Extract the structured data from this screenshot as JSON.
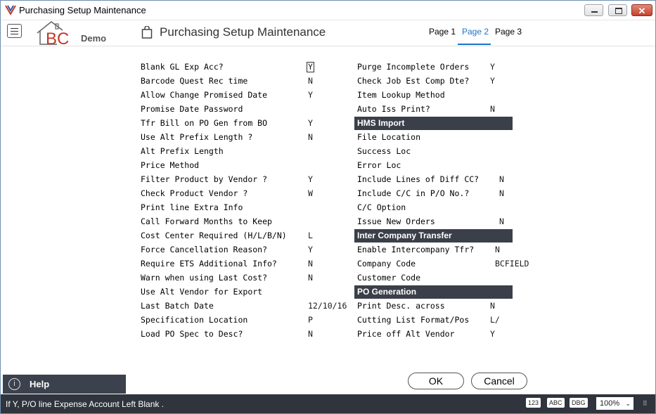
{
  "window": {
    "title": "Purchasing Setup Maintenance"
  },
  "header": {
    "logo_text": "Demo",
    "logo_letters": "BC",
    "page_title": "Purchasing Setup Maintenance",
    "tabs": [
      {
        "label": "Page 1"
      },
      {
        "label": "Page 2",
        "active": true
      },
      {
        "label": "Page 3"
      }
    ]
  },
  "left_fields": [
    {
      "label": "Blank GL Exp Acc?",
      "value": "Y"
    },
    {
      "label": "Barcode Quest Rec time",
      "value": "N"
    },
    {
      "label": "Allow Change Promised Date",
      "value": "Y"
    },
    {
      "label": "Promise Date Password",
      "value": ""
    },
    {
      "label": "Tfr Bill on PO Gen from BO",
      "value": "Y"
    },
    {
      "label": "Use Alt Prefix Length ?",
      "value": "N"
    },
    {
      "label": "Alt Prefix Length",
      "value": ""
    },
    {
      "label": "Price Method",
      "value": ""
    },
    {
      "label": "Filter Product by Vendor ?",
      "value": "Y"
    },
    {
      "label": "Check Product Vendor ?",
      "value": "W"
    },
    {
      "label": "Print line Extra Info",
      "value": ""
    },
    {
      "label": "Call Forward Months to Keep",
      "value": ""
    },
    {
      "label": "Cost Center Required (H/L/B/N)",
      "value": "L"
    },
    {
      "label": "Force Cancellation Reason?",
      "value": "Y"
    },
    {
      "label": "Require ETS Additional Info?",
      "value": "N"
    },
    {
      "label": "Warn when using Last Cost?",
      "value": "N"
    },
    {
      "label": "Use Alt Vendor for Export",
      "value": ""
    },
    {
      "label": "Last Batch Date",
      "value": "12/10/16"
    },
    {
      "label": "Specification Location",
      "value": "P"
    },
    {
      "label": "Load PO Spec to Desc?",
      "value": "N"
    }
  ],
  "right_fields": [
    {
      "label": "Purge Incomplete Orders",
      "value": "Y"
    },
    {
      "label": "Check Job Est Comp Dte?",
      "value": "Y"
    },
    {
      "label": "Item Lookup Method",
      "value": ""
    },
    {
      "label": "Auto Iss Print?",
      "value": "N"
    }
  ],
  "hms_import": {
    "title": "HMS Import",
    "fields": [
      {
        "label": "File Location",
        "value": ""
      },
      {
        "label": "Success Loc",
        "value": ""
      },
      {
        "label": "Error Loc",
        "value": ""
      },
      {
        "label": "Include Lines of Diff CC?",
        "value": "N"
      },
      {
        "label": "Include C/C in P/O No.?",
        "value": "N"
      },
      {
        "label": "C/C Option",
        "value": ""
      },
      {
        "label": "Issue New Orders",
        "value": "N"
      }
    ]
  },
  "inter_company": {
    "title": "Inter Company Transfer",
    "fields": [
      {
        "label": "Enable Intercompany Tfr?",
        "value": "N"
      },
      {
        "label": "Company Code",
        "value": "BCFIELD"
      },
      {
        "label": "Customer Code",
        "value": ""
      }
    ]
  },
  "po_generation": {
    "title": "PO Generation",
    "fields": [
      {
        "label": "Print Desc. across",
        "value": "N"
      },
      {
        "label": "Cutting List Format/Pos",
        "value": "L/"
      },
      {
        "label": "Price off Alt Vendor",
        "value": "Y"
      }
    ]
  },
  "help": {
    "label": "Help",
    "icon_glyph": "i"
  },
  "buttons": {
    "ok": "OK",
    "cancel": "Cancel"
  },
  "status": {
    "message": "If Y, P/O line Expense Account Left Blank .",
    "badges": [
      "123",
      "ABC",
      "DBG"
    ],
    "zoom": "100%"
  },
  "colors": {
    "section_bg": "#3b3f49",
    "status_bg": "#2f343d",
    "accent": "#1a73c7",
    "close_button": "#c5412c"
  }
}
